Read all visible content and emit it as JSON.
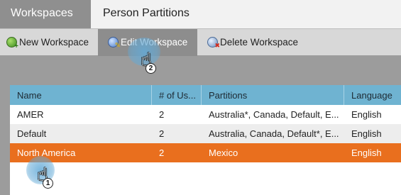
{
  "tabs": [
    {
      "label": "Workspaces",
      "active": true
    },
    {
      "label": "Person Partitions",
      "active": false
    }
  ],
  "toolbar": {
    "new_label": "New Workspace",
    "edit_label": "Edit Workspace",
    "delete_label": "Delete Workspace"
  },
  "table": {
    "columns": [
      "Name",
      "# of Us...",
      "Partitions",
      "Language"
    ],
    "rows": [
      {
        "name": "AMER",
        "users": "2",
        "partitions": "Australia*, Canada, Default, E...",
        "language": "English"
      },
      {
        "name": "Default",
        "users": "2",
        "partitions": "Australia, Canada, Default*, E...",
        "language": "English"
      },
      {
        "name": "North America",
        "users": "2",
        "partitions": "Mexico",
        "language": "English",
        "selected": true
      }
    ]
  },
  "callouts": {
    "step1": "1",
    "step2": "2"
  },
  "colors": {
    "selected_row": "#e96f1e",
    "header": "#6fb3d1",
    "active_tab": "#8f8f8f",
    "halo": "#63aad7"
  },
  "icons": {
    "new": "globe-add-icon",
    "edit": "globe-edit-icon",
    "delete": "globe-delete-icon",
    "pointer": "hand-pointer-icon"
  }
}
